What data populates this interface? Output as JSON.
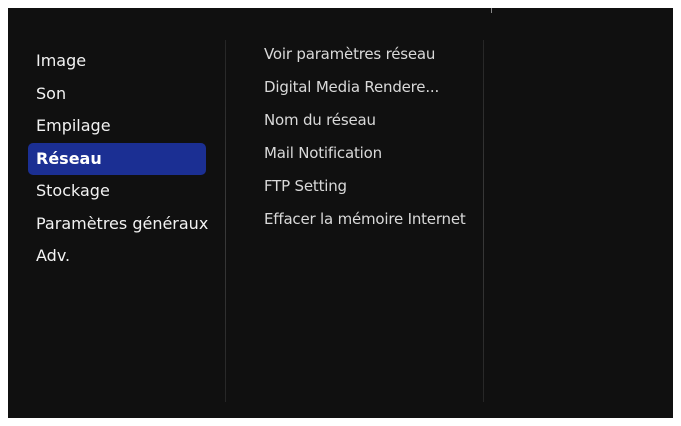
{
  "main_menu": {
    "items": [
      {
        "label": "Image",
        "selected": false
      },
      {
        "label": "Son",
        "selected": false
      },
      {
        "label": "Empilage",
        "selected": false
      },
      {
        "label": "Réseau",
        "selected": true
      },
      {
        "label": "Stockage",
        "selected": false
      },
      {
        "label": "Paramètres généraux",
        "selected": false
      },
      {
        "label": "Adv.",
        "selected": false
      }
    ]
  },
  "sub_menu": {
    "items": [
      {
        "label": "Voir paramètres réseau"
      },
      {
        "label": "Digital Media Rendere..."
      },
      {
        "label": "Nom du réseau"
      },
      {
        "label": "Mail Notification"
      },
      {
        "label": "FTP Setting"
      },
      {
        "label": "Effacer la mémoire Internet"
      }
    ]
  },
  "colors": {
    "background": "#101010",
    "selection": "#1b2f93",
    "text": "#f2f2f2",
    "submenu_text": "#d9d9d9"
  }
}
